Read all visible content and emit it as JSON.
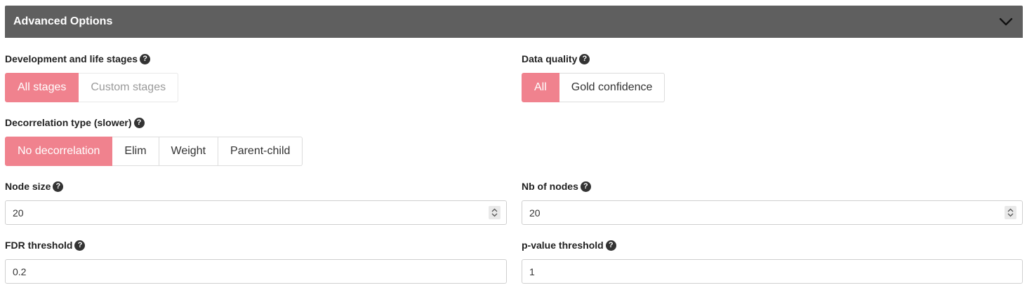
{
  "panel": {
    "title": "Advanced Options"
  },
  "help_glyph": "?",
  "dev_stages": {
    "label": "Development and life stages",
    "options": [
      "All stages",
      "Custom stages"
    ]
  },
  "data_quality": {
    "label": "Data quality",
    "options": [
      "All",
      "Gold confidence"
    ]
  },
  "decorrelation": {
    "label": "Decorrelation type (slower)",
    "options": [
      "No decorrelation",
      "Elim",
      "Weight",
      "Parent-child"
    ]
  },
  "node_size": {
    "label": "Node size",
    "value": "20"
  },
  "nb_nodes": {
    "label": "Nb of nodes",
    "value": "20"
  },
  "fdr": {
    "label": "FDR threshold",
    "value": "0.2"
  },
  "pvalue": {
    "label": "p-value threshold",
    "value": "1"
  },
  "colors": {
    "header_bg": "#5f5f5f",
    "accent": "#f0828e"
  },
  "icons": {
    "collapse": "chevron-down-icon",
    "help": "question-circle-icon",
    "spinner": "updown-spinner-icon"
  }
}
